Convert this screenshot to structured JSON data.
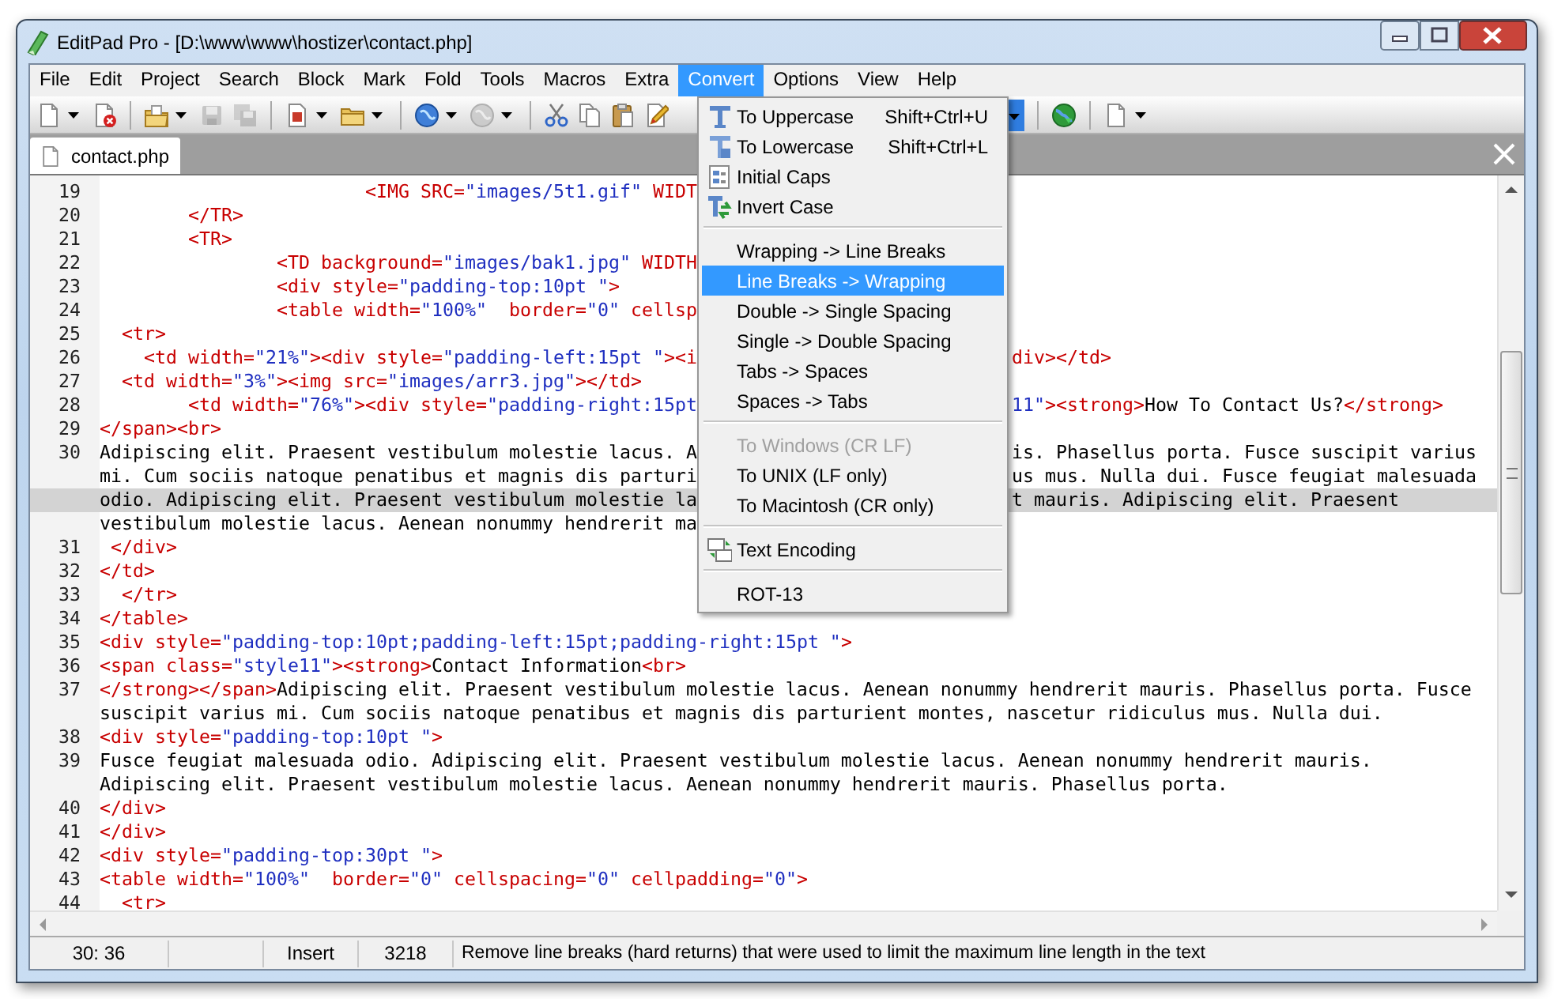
{
  "window": {
    "title": "EditPad Pro - [D:\\www\\www\\hostizer\\contact.php]"
  },
  "menu_bar": [
    {
      "label": "File",
      "selected": false
    },
    {
      "label": "Edit",
      "selected": false
    },
    {
      "label": "Project",
      "selected": false
    },
    {
      "label": "Search",
      "selected": false
    },
    {
      "label": "Block",
      "selected": false
    },
    {
      "label": "Mark",
      "selected": false
    },
    {
      "label": "Fold",
      "selected": false
    },
    {
      "label": "Tools",
      "selected": false
    },
    {
      "label": "Macros",
      "selected": false
    },
    {
      "label": "Extra",
      "selected": false
    },
    {
      "label": "Convert",
      "selected": true
    },
    {
      "label": "Options",
      "selected": false
    },
    {
      "label": "View",
      "selected": false
    },
    {
      "label": "Help",
      "selected": false
    }
  ],
  "toolbar": [
    {
      "kind": "new",
      "dropdown": true,
      "disabled": false
    },
    {
      "kind": "close_file",
      "dropdown": false,
      "disabled": false
    },
    {
      "kind": "separator"
    },
    {
      "kind": "open",
      "dropdown": true,
      "disabled": false
    },
    {
      "kind": "save",
      "dropdown": false,
      "disabled": true
    },
    {
      "kind": "save_all",
      "dropdown": false,
      "disabled": true
    },
    {
      "kind": "separator"
    },
    {
      "kind": "reload",
      "dropdown": true,
      "disabled": false
    },
    {
      "kind": "folder",
      "dropdown": true,
      "disabled": false
    },
    {
      "kind": "separator"
    },
    {
      "kind": "web_open",
      "dropdown": true,
      "disabled": false
    },
    {
      "kind": "web_save",
      "dropdown": true,
      "disabled": true
    },
    {
      "kind": "separator"
    },
    {
      "kind": "cut",
      "dropdown": false,
      "disabled": false
    },
    {
      "kind": "copy",
      "dropdown": false,
      "disabled": false
    },
    {
      "kind": "paste",
      "dropdown": false,
      "disabled": false
    },
    {
      "kind": "edit",
      "dropdown": false,
      "disabled": false
    },
    {
      "kind": "covered"
    },
    {
      "kind": "dropdown_active"
    },
    {
      "kind": "separator"
    },
    {
      "kind": "web_green",
      "dropdown": false,
      "disabled": false
    },
    {
      "kind": "separator"
    },
    {
      "kind": "new",
      "dropdown": true,
      "disabled": false
    }
  ],
  "tabs": [
    {
      "label": "contact.php",
      "selected": true
    }
  ],
  "editor": {
    "lines": [
      {
        "number": "19",
        "rows": [
          {
            "current": false,
            "parts": [
              {
                "kind": "markup",
                "text": "                        <IMG SRC="
              },
              {
                "kind": "value",
                "text": "\"images/5t1.gif\""
              },
              {
                "kind": "markup",
                "text": " WIDT"
              }
            ]
          }
        ]
      },
      {
        "number": "20",
        "rows": [
          {
            "current": false,
            "parts": [
              {
                "kind": "markup",
                "text": "        </TR>"
              }
            ]
          }
        ]
      },
      {
        "number": "21",
        "rows": [
          {
            "current": false,
            "parts": [
              {
                "kind": "markup",
                "text": "        <TR>"
              }
            ]
          }
        ]
      },
      {
        "number": "22",
        "rows": [
          {
            "current": false,
            "parts": [
              {
                "kind": "markup",
                "text": "                <TD background="
              },
              {
                "kind": "value",
                "text": "\"images/bak1.jpg\""
              },
              {
                "kind": "markup",
                "text": " WIDTH"
              }
            ]
          }
        ]
      },
      {
        "number": "23",
        "rows": [
          {
            "current": false,
            "parts": [
              {
                "kind": "markup",
                "text": "                <div style="
              },
              {
                "kind": "value",
                "text": "\"padding-top:10pt \""
              },
              {
                "kind": "markup",
                "text": ">"
              }
            ]
          }
        ]
      },
      {
        "number": "24",
        "rows": [
          {
            "current": false,
            "parts": [
              {
                "kind": "markup",
                "text": "                <table width="
              },
              {
                "kind": "value",
                "text": "\"100%\""
              },
              {
                "kind": "markup",
                "text": "  border="
              },
              {
                "kind": "value",
                "text": "\"0\""
              },
              {
                "kind": "markup",
                "text": " cellsp"
              }
            ]
          }
        ]
      },
      {
        "number": "25",
        "rows": [
          {
            "current": false,
            "parts": [
              {
                "kind": "markup",
                "text": "  <tr>"
              }
            ]
          }
        ]
      },
      {
        "number": "26",
        "rows": [
          {
            "current": false,
            "parts": [
              {
                "kind": "markup",
                "text": "    <td width="
              },
              {
                "kind": "value",
                "text": "\"21%\""
              },
              {
                "kind": "markup",
                "text": "><div style="
              },
              {
                "kind": "value",
                "text": "\"padding-left:15pt \""
              },
              {
                "kind": "markup",
                "text": "><i"
              }
            ],
            "parts_right": [
              {
                "kind": "markup",
                "text": "div></td>"
              }
            ]
          }
        ]
      },
      {
        "number": "27",
        "rows": [
          {
            "current": false,
            "parts": [
              {
                "kind": "markup",
                "text": "  <td width="
              },
              {
                "kind": "value",
                "text": "\"3%\""
              },
              {
                "kind": "markup",
                "text": "><img src="
              },
              {
                "kind": "value",
                "text": "\"images/arr3.jpg\""
              },
              {
                "kind": "markup",
                "text": "></td>"
              }
            ]
          }
        ]
      },
      {
        "number": "28",
        "rows": [
          {
            "current": false,
            "parts": [
              {
                "kind": "markup",
                "text": "        <td width="
              },
              {
                "kind": "value",
                "text": "\"76%\""
              },
              {
                "kind": "markup",
                "text": "><div style="
              },
              {
                "kind": "value",
                "text": "\"padding-right:15pt"
              }
            ],
            "parts_right": [
              {
                "kind": "value",
                "text": "11\""
              },
              {
                "kind": "markup",
                "text": "><strong>"
              },
              {
                "kind": "text",
                "text": "How To Contact Us?"
              },
              {
                "kind": "markup",
                "text": "</strong>"
              }
            ]
          }
        ]
      },
      {
        "number": "29",
        "rows": [
          {
            "current": false,
            "parts": [
              {
                "kind": "markup",
                "text": "</span><br>"
              }
            ]
          }
        ]
      },
      {
        "number": "30",
        "rows": [
          {
            "current": false,
            "parts": [
              {
                "kind": "text",
                "text": "Adipiscing elit. Praesent vestibulum molestie lacus. A"
              }
            ],
            "parts_right": [
              {
                "kind": "text",
                "text": "is. Phasellus porta. Fusce suscipit varius"
              }
            ]
          },
          {
            "current": false,
            "parts": [
              {
                "kind": "text",
                "text": "mi. Cum sociis natoque penatibus et magnis dis parturi"
              }
            ],
            "parts_right": [
              {
                "kind": "text",
                "text": "us mus. Nulla dui. Fusce feugiat malesuada"
              }
            ]
          },
          {
            "current": true,
            "parts": [
              {
                "kind": "text",
                "text": "odio. Adipiscing elit. Praesent vestibulum molestie la"
              }
            ],
            "parts_right": [
              {
                "kind": "text",
                "text": "t mauris. Adipiscing elit. Praesent"
              }
            ]
          },
          {
            "current": false,
            "parts": [
              {
                "kind": "text",
                "text": "vestibulum molestie lacus. Aenean nonummy hendrerit ma"
              }
            ]
          }
        ]
      },
      {
        "number": "31",
        "rows": [
          {
            "current": false,
            "parts": [
              {
                "kind": "markup",
                "text": " </div>"
              }
            ]
          }
        ]
      },
      {
        "number": "32",
        "rows": [
          {
            "current": false,
            "parts": [
              {
                "kind": "markup",
                "text": "</td>"
              }
            ]
          }
        ]
      },
      {
        "number": "33",
        "rows": [
          {
            "current": false,
            "parts": [
              {
                "kind": "markup",
                "text": "  </tr>"
              }
            ]
          }
        ]
      },
      {
        "number": "34",
        "rows": [
          {
            "current": false,
            "parts": [
              {
                "kind": "markup",
                "text": "</table>"
              }
            ]
          }
        ]
      },
      {
        "number": "35",
        "rows": [
          {
            "current": false,
            "parts": [
              {
                "kind": "markup",
                "text": "<div style="
              },
              {
                "kind": "value",
                "text": "\"padding-top:10pt;padding-left:15pt;padding-right:15pt \""
              },
              {
                "kind": "markup",
                "text": ">"
              }
            ]
          }
        ]
      },
      {
        "number": "36",
        "rows": [
          {
            "current": false,
            "parts": [
              {
                "kind": "markup",
                "text": "<span class="
              },
              {
                "kind": "value",
                "text": "\"style11\""
              },
              {
                "kind": "markup",
                "text": "><strong>"
              },
              {
                "kind": "text",
                "text": "Contact Information"
              },
              {
                "kind": "markup",
                "text": "<br>"
              }
            ]
          }
        ]
      },
      {
        "number": "37",
        "rows": [
          {
            "current": false,
            "parts": [
              {
                "kind": "markup",
                "text": "</strong></span>"
              },
              {
                "kind": "text",
                "text": "Adipiscing elit. Praesent vestibulum molestie lacus. Aenean nonummy hendrerit mauris. Phasellus porta. Fusce"
              }
            ]
          },
          {
            "current": false,
            "parts": [
              {
                "kind": "text",
                "text": "suscipit varius mi. Cum sociis natoque penatibus et magnis dis parturient montes, nascetur ridiculus mus. Nulla dui."
              }
            ]
          }
        ]
      },
      {
        "number": "38",
        "rows": [
          {
            "current": false,
            "parts": [
              {
                "kind": "markup",
                "text": "<div style="
              },
              {
                "kind": "value",
                "text": "\"padding-top:10pt \""
              },
              {
                "kind": "markup",
                "text": ">"
              }
            ]
          }
        ]
      },
      {
        "number": "39",
        "rows": [
          {
            "current": false,
            "parts": [
              {
                "kind": "text",
                "text": "Fusce feugiat malesuada odio. Adipiscing elit. Praesent vestibulum molestie lacus. Aenean nonummy hendrerit mauris."
              }
            ]
          },
          {
            "current": false,
            "parts": [
              {
                "kind": "text",
                "text": "Adipiscing elit. Praesent vestibulum molestie lacus. Aenean nonummy hendrerit mauris. Phasellus porta."
              }
            ]
          }
        ]
      },
      {
        "number": "40",
        "rows": [
          {
            "current": false,
            "parts": [
              {
                "kind": "markup",
                "text": "</div>"
              }
            ]
          }
        ]
      },
      {
        "number": "41",
        "rows": [
          {
            "current": false,
            "parts": [
              {
                "kind": "markup",
                "text": "</div>"
              }
            ]
          }
        ]
      },
      {
        "number": "42",
        "rows": [
          {
            "current": false,
            "parts": [
              {
                "kind": "markup",
                "text": "<div style="
              },
              {
                "kind": "value",
                "text": "\"padding-top:30pt \""
              },
              {
                "kind": "markup",
                "text": ">"
              }
            ]
          }
        ]
      },
      {
        "number": "43",
        "rows": [
          {
            "current": false,
            "parts": [
              {
                "kind": "markup",
                "text": "<table width="
              },
              {
                "kind": "value",
                "text": "\"100%\""
              },
              {
                "kind": "markup",
                "text": "  border="
              },
              {
                "kind": "value",
                "text": "\"0\""
              },
              {
                "kind": "markup",
                "text": " cellspacing="
              },
              {
                "kind": "value",
                "text": "\"0\""
              },
              {
                "kind": "markup",
                "text": " cellpadding="
              },
              {
                "kind": "value",
                "text": "\"0\""
              },
              {
                "kind": "markup",
                "text": ">"
              }
            ]
          }
        ]
      },
      {
        "number": "44",
        "rows": [
          {
            "current": false,
            "parts": [
              {
                "kind": "markup",
                "text": "  <tr>"
              }
            ]
          }
        ]
      }
    ]
  },
  "convert_menu": [
    {
      "kind": "uppercase",
      "label": "To Uppercase",
      "shortcut": "Shift+Ctrl+U",
      "selected": false,
      "disabled": false
    },
    {
      "kind": "lowercase",
      "label": "To Lowercase",
      "shortcut": "Shift+Ctrl+L",
      "selected": false,
      "disabled": false
    },
    {
      "kind": "initial_caps",
      "label": "Initial Caps",
      "selected": false,
      "disabled": false
    },
    {
      "kind": "invert_case",
      "label": "Invert Case",
      "selected": false,
      "disabled": false
    },
    {
      "kind": "separator"
    },
    {
      "kind": "plain",
      "label": "Wrapping -> Line Breaks",
      "selected": false,
      "disabled": false
    },
    {
      "kind": "plain",
      "label": "Line Breaks -> Wrapping",
      "selected": true,
      "disabled": false
    },
    {
      "kind": "plain",
      "label": "Double -> Single Spacing",
      "selected": false,
      "disabled": false
    },
    {
      "kind": "plain",
      "label": "Single -> Double Spacing",
      "selected": false,
      "disabled": false
    },
    {
      "kind": "plain",
      "label": "Tabs -> Spaces",
      "selected": false,
      "disabled": false
    },
    {
      "kind": "plain",
      "label": "Spaces -> Tabs",
      "selected": false,
      "disabled": false
    },
    {
      "kind": "separator"
    },
    {
      "kind": "plain",
      "label": "To Windows (CR LF)",
      "selected": false,
      "disabled": true
    },
    {
      "kind": "plain",
      "label": "To UNIX (LF only)",
      "selected": false,
      "disabled": false
    },
    {
      "kind": "plain",
      "label": "To Macintosh (CR only)",
      "selected": false,
      "disabled": false
    },
    {
      "kind": "separator"
    },
    {
      "kind": "encoding",
      "label": "Text Encoding",
      "selected": false,
      "disabled": false
    },
    {
      "kind": "separator"
    },
    {
      "kind": "plain",
      "label": "ROT-13",
      "selected": false,
      "disabled": false
    }
  ],
  "status_bar": {
    "position": "30: 36",
    "mode": "Insert",
    "panel_4": "3218",
    "message": "Remove line breaks (hard returns) that were used to limit the maximum line length in the text"
  }
}
